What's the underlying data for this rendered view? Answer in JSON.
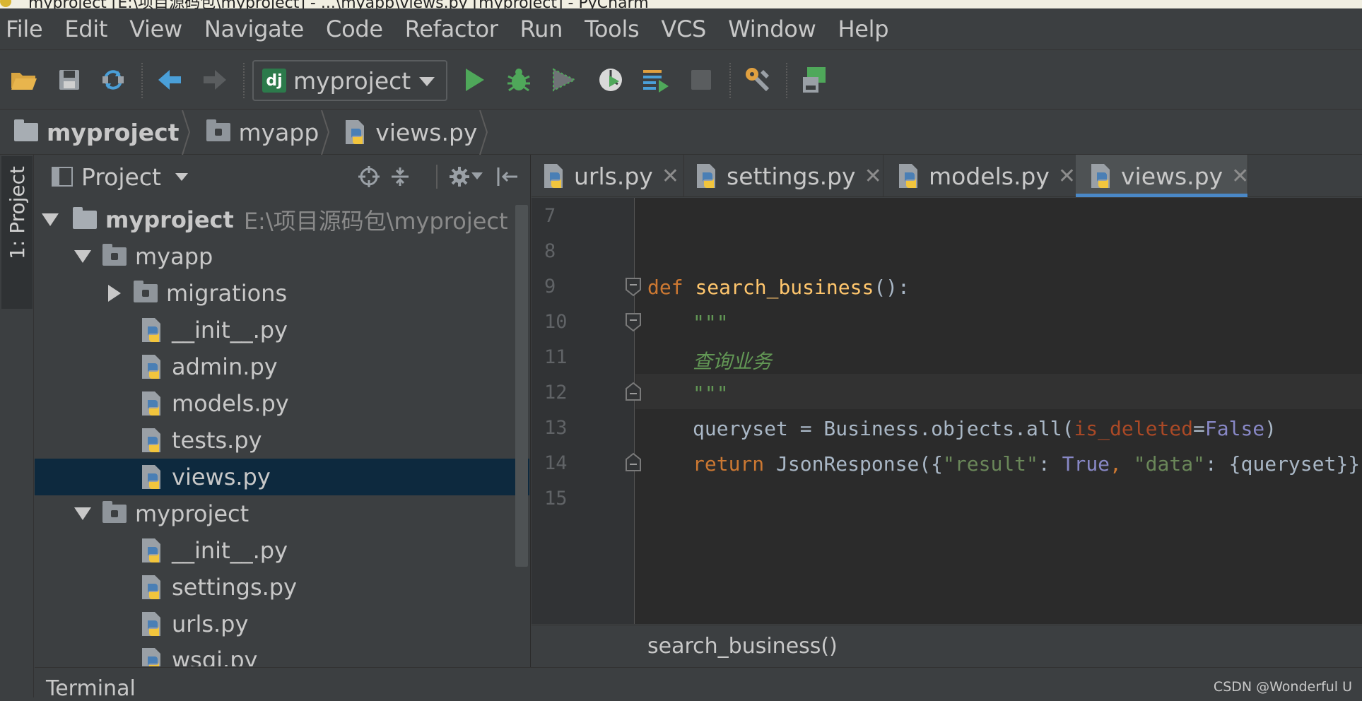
{
  "window_title_fragment": "myproject [E:\\项目源码包\\myproject] - ...\\myapp\\views.py [myproject] - PyCharm",
  "menu": [
    "File",
    "Edit",
    "View",
    "Navigate",
    "Code",
    "Refactor",
    "Run",
    "Tools",
    "VCS",
    "Window",
    "Help"
  ],
  "toolbar": {
    "run_config": "myproject",
    "run_config_icon": "dj"
  },
  "breadcrumb": [
    "myproject",
    "myapp",
    "views.py"
  ],
  "left_tool_tab": "1: Project",
  "project_panel": {
    "title": "Project",
    "tree": [
      {
        "label": "myproject",
        "path": "E:\\项目源码包\\myproject"
      },
      {
        "label": "myapp"
      },
      {
        "label": "migrations"
      },
      {
        "label": "__init__.py"
      },
      {
        "label": "admin.py"
      },
      {
        "label": "models.py"
      },
      {
        "label": "tests.py"
      },
      {
        "label": "views.py"
      },
      {
        "label": "myproject"
      },
      {
        "label": "__init__.py"
      },
      {
        "label": "settings.py"
      },
      {
        "label": "urls.py"
      },
      {
        "label": "wsgi.py"
      }
    ]
  },
  "tabs": [
    {
      "label": "urls.py",
      "close": "✕"
    },
    {
      "label": "settings.py",
      "close": "✕"
    },
    {
      "label": "models.py",
      "close": "✕"
    },
    {
      "label": "views.py",
      "close": "✕"
    }
  ],
  "editor": {
    "line_numbers": [
      "7",
      "8",
      "9",
      "10",
      "11",
      "12",
      "13",
      "14",
      "15"
    ],
    "code": {
      "l9_kw": "def",
      "l9_fn": "search_business",
      "l9_rest": "():",
      "l10": "\"\"\"",
      "l11": "查询业务",
      "l12": "\"\"\"",
      "l13_a": "queryset = Business.objects.all(",
      "l13_param": "is_deleted",
      "l13_eq": "=",
      "l13_bool": "False",
      "l13_close": ")",
      "l14_kw": "return",
      "l14_a": " JsonResponse({",
      "l14_s1": "\"result\"",
      "l14_colon1": ": ",
      "l14_bool": "True",
      "l14_comma": ", ",
      "l14_s2": "\"data\"",
      "l14_rest": ": {queryset}})"
    },
    "structure_breadcrumb": "search_business()"
  },
  "bottom": {
    "tool_window": "Terminal",
    "watermark": "CSDN @Wonderful    U"
  }
}
